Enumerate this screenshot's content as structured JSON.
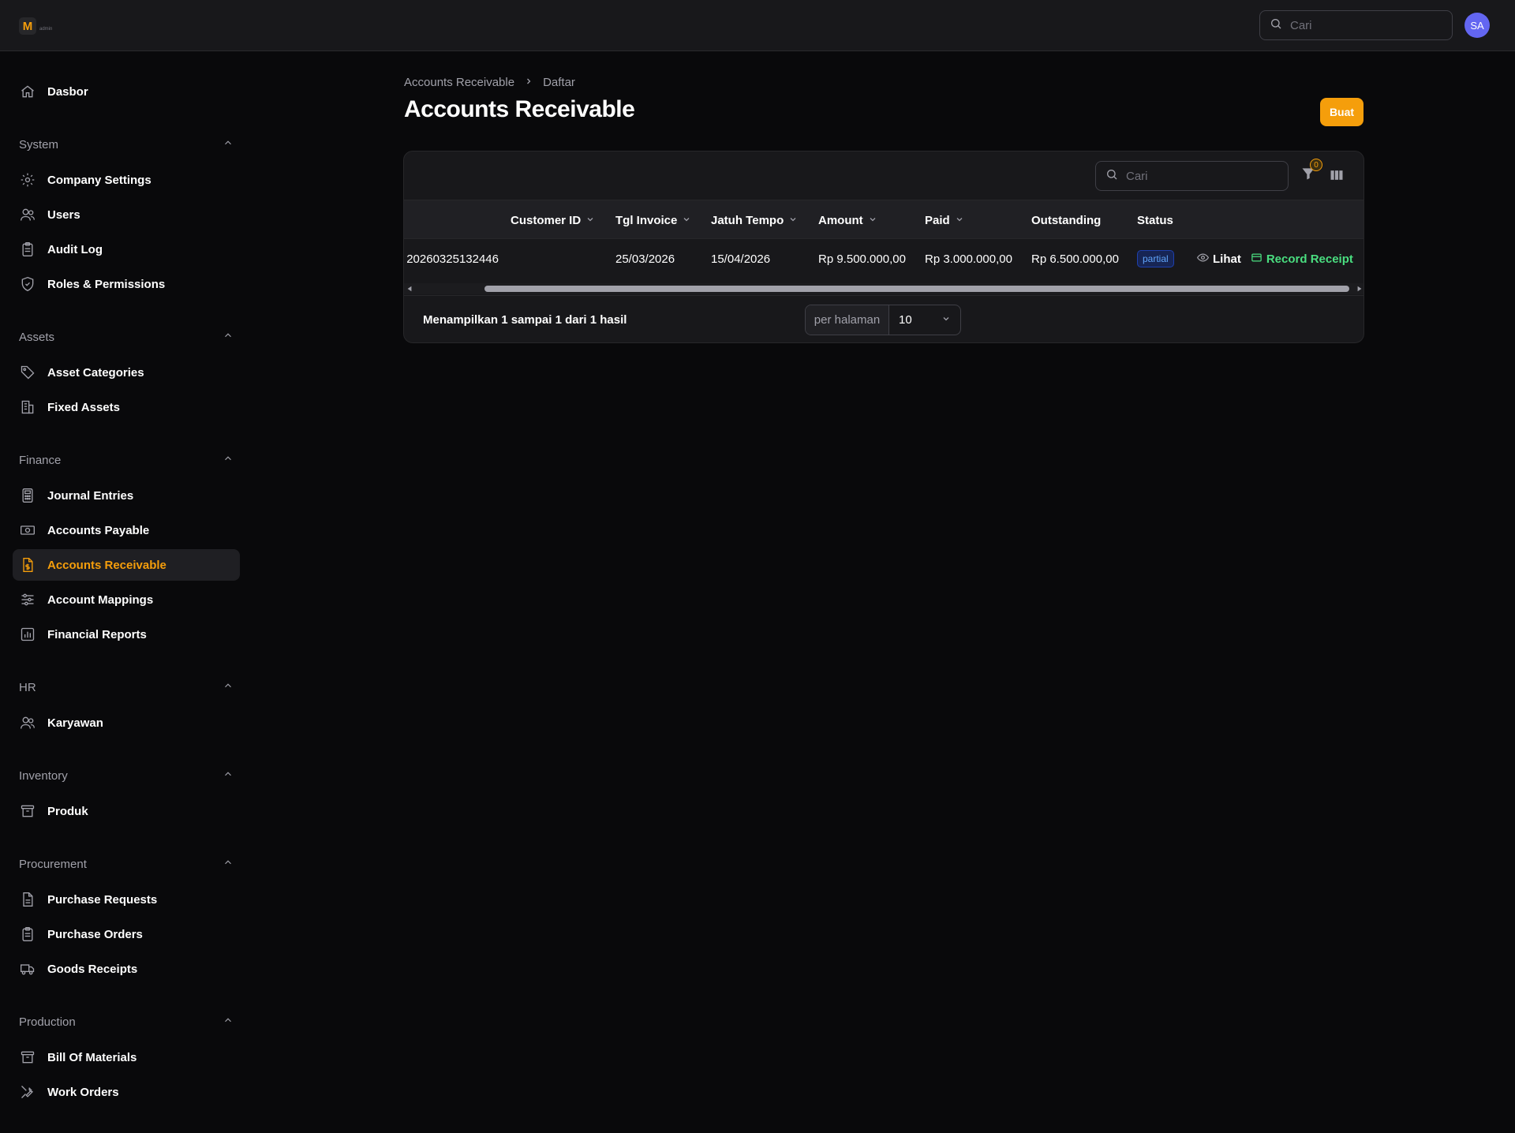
{
  "app": {
    "logo_letter": "M",
    "logo_text": "admin"
  },
  "header": {
    "search_placeholder": "Cari",
    "avatar_initials": "SA"
  },
  "sidebar": {
    "dashboard": {
      "label": "Dasbor",
      "icon": "home-icon"
    },
    "groups": [
      {
        "label": "System",
        "items": [
          {
            "label": "Company Settings",
            "icon": "gear-icon"
          },
          {
            "label": "Users",
            "icon": "users-icon"
          },
          {
            "label": "Audit Log",
            "icon": "clipboard-icon"
          },
          {
            "label": "Roles & Permissions",
            "icon": "shield-icon"
          }
        ]
      },
      {
        "label": "Assets",
        "items": [
          {
            "label": "Asset Categories",
            "icon": "tag-icon"
          },
          {
            "label": "Fixed Assets",
            "icon": "building-icon"
          }
        ]
      },
      {
        "label": "Finance",
        "items": [
          {
            "label": "Journal Entries",
            "icon": "calculator-icon"
          },
          {
            "label": "Accounts Payable",
            "icon": "banknote-icon"
          },
          {
            "label": "Accounts Receivable",
            "icon": "document-dollar-icon",
            "active": true
          },
          {
            "label": "Account Mappings",
            "icon": "sliders-icon"
          },
          {
            "label": "Financial Reports",
            "icon": "bar-chart-icon"
          }
        ]
      },
      {
        "label": "HR",
        "items": [
          {
            "label": "Karyawan",
            "icon": "users-icon"
          }
        ]
      },
      {
        "label": "Inventory",
        "items": [
          {
            "label": "Produk",
            "icon": "archive-box-icon"
          }
        ]
      },
      {
        "label": "Procurement",
        "items": [
          {
            "label": "Purchase Requests",
            "icon": "document-icon"
          },
          {
            "label": "Purchase Orders",
            "icon": "clipboard-icon"
          },
          {
            "label": "Goods Receipts",
            "icon": "truck-icon"
          }
        ]
      },
      {
        "label": "Production",
        "items": [
          {
            "label": "Bill Of Materials",
            "icon": "archive-box-icon"
          },
          {
            "label": "Work Orders",
            "icon": "wrench-icon"
          }
        ]
      }
    ]
  },
  "breadcrumb": {
    "parent": "Accounts Receivable",
    "current": "Daftar"
  },
  "page": {
    "title": "Accounts Receivable",
    "create_label": "Buat"
  },
  "table": {
    "search_placeholder": "Cari",
    "filter_count": "0",
    "columns": [
      {
        "label": "Customer ID",
        "sortable": true
      },
      {
        "label": "Tgl Invoice",
        "sortable": true
      },
      {
        "label": "Jatuh Tempo",
        "sortable": true
      },
      {
        "label": "Amount",
        "sortable": true
      },
      {
        "label": "Paid",
        "sortable": true
      },
      {
        "label": "Outstanding",
        "sortable": false
      },
      {
        "label": "Status",
        "sortable": false
      }
    ],
    "rows": [
      {
        "id_fragment": "20260325132446",
        "customer_id": "",
        "invoice_date": "25/03/2026",
        "due_date": "15/04/2026",
        "amount": "Rp 9.500.000,00",
        "paid": "Rp 3.000.000,00",
        "outstanding": "Rp 6.500.000,00",
        "status": "partial",
        "view_label": "Lihat",
        "receipt_label": "Record Receipt"
      }
    ],
    "scroll_position": 0.92,
    "summary": "Menampilkan 1 sampai 1 dari 1 hasil",
    "per_page_label": "per halaman",
    "per_page_value": "10"
  },
  "colors": {
    "accent": "#f59e0b",
    "success": "#4ade80",
    "status_partial": "#60a5fa",
    "avatar": "#6366f1"
  }
}
